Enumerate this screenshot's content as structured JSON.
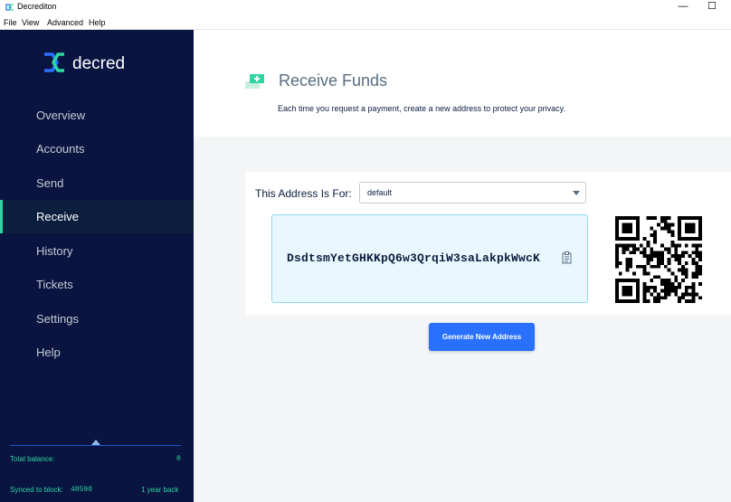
{
  "window": {
    "title": "Decrediton",
    "minimize": "—",
    "maximize": "☐"
  },
  "menu": [
    {
      "label": "File"
    },
    {
      "label": "View"
    },
    {
      "label": "Advanced"
    },
    {
      "label": "Help"
    }
  ],
  "sidebar": {
    "logo_text": "decred",
    "items": [
      {
        "label": "Overview"
      },
      {
        "label": "Accounts"
      },
      {
        "label": "Send"
      },
      {
        "label": "Receive",
        "active": true
      },
      {
        "label": "History"
      },
      {
        "label": "Tickets"
      },
      {
        "label": "Settings"
      },
      {
        "label": "Help"
      }
    ],
    "total_balance_label": "Total balance:",
    "total_balance_value": "0",
    "synced_label": "Synced to block:",
    "synced_block": "48590",
    "synced_ago": "1 year back"
  },
  "header": {
    "title": "Receive Funds",
    "description": "Each time you request a payment, create a new address to protect your privacy."
  },
  "receive": {
    "address_for_label": "This Address Is For:",
    "account_selected": "default",
    "address": "DsdtsmYetGHKKpQ6w3QrqiW3saLakpkWwcK",
    "generate_button": "Generate New Address"
  },
  "colors": {
    "sidebar_bg": "#091440",
    "accent_green": "#2ed6a1",
    "accent_blue": "#2970ff",
    "address_bg": "#e9f8fe"
  },
  "icons": {
    "app": "decred-logo-icon",
    "header": "receive-funds-icon",
    "copy": "clipboard-copy-icon",
    "select_caret": "caret-down-icon"
  }
}
